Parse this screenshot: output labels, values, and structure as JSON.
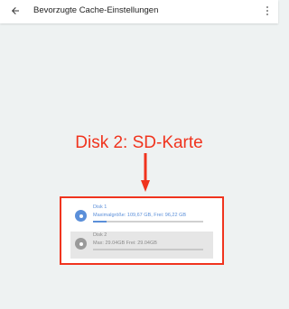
{
  "appbar": {
    "title": "Bevorzugte Cache-Einstellungen",
    "back_icon": "arrow-left-icon",
    "menu_icon": "more-vertical-icon"
  },
  "annotation": {
    "label": "Disk 2: SD-Karte",
    "color": "#f0341e"
  },
  "disks": [
    {
      "name": "Disk 1",
      "info": "Maximalgröße: 109,67 GB, Frei: 96,22 GB",
      "color": "#5b8fd9",
      "used_fraction": 0.12,
      "selected": true
    },
    {
      "name": "Disk 2",
      "info": "Max: 29.04GB Frei: 29.04GB",
      "color": "#9a9a9a",
      "used_fraction": 0.0,
      "selected": false
    }
  ]
}
